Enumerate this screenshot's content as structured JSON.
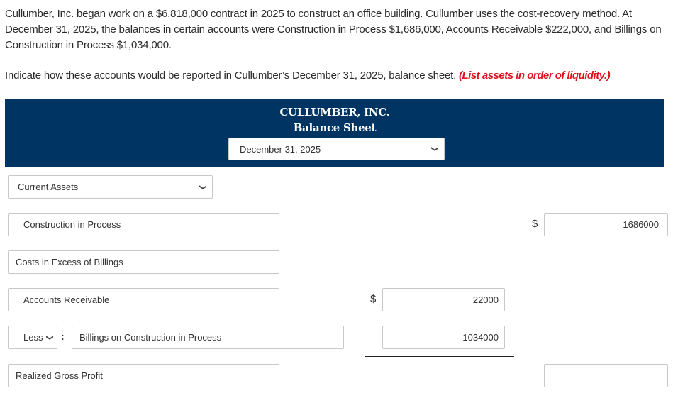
{
  "question": {
    "paragraph": "Cullumber, Inc. began work on a $6,818,000 contract in 2025 to construct an office building. Cullumber uses the cost-recovery method. At December 31, 2025, the balances in certain accounts were Construction in Process $1,686,000, Accounts Receivable $222,000, and Billings on Construction in Process $1,034,000.",
    "instruction": "Indicate how these accounts would be reported in Cullumber’s December 31, 2025, balance sheet.",
    "instruction_note": "(List assets in order of liquidity.)"
  },
  "header": {
    "company": "CULLUMBER, INC.",
    "statement": "Balance Sheet",
    "date_select": "December 31, 2025"
  },
  "colors": {
    "header_bg": "#003462",
    "note_red": "#e0101f"
  },
  "rows": {
    "section_select": "Current Assets",
    "construction_in_process": {
      "label": "Construction in Process",
      "currency": "$",
      "value": "1686000"
    },
    "costs_in_excess": {
      "label": "Costs in Excess of Billings"
    },
    "accounts_receivable": {
      "label": "Accounts Receivable",
      "currency": "$",
      "value": "22000"
    },
    "billings": {
      "modifier_select": "Less",
      "separator": ":",
      "label": "Billings on Construction in Process",
      "value": "1034000"
    },
    "realized_gross_profit": {
      "label": "Realized Gross Profit",
      "value": ""
    }
  }
}
